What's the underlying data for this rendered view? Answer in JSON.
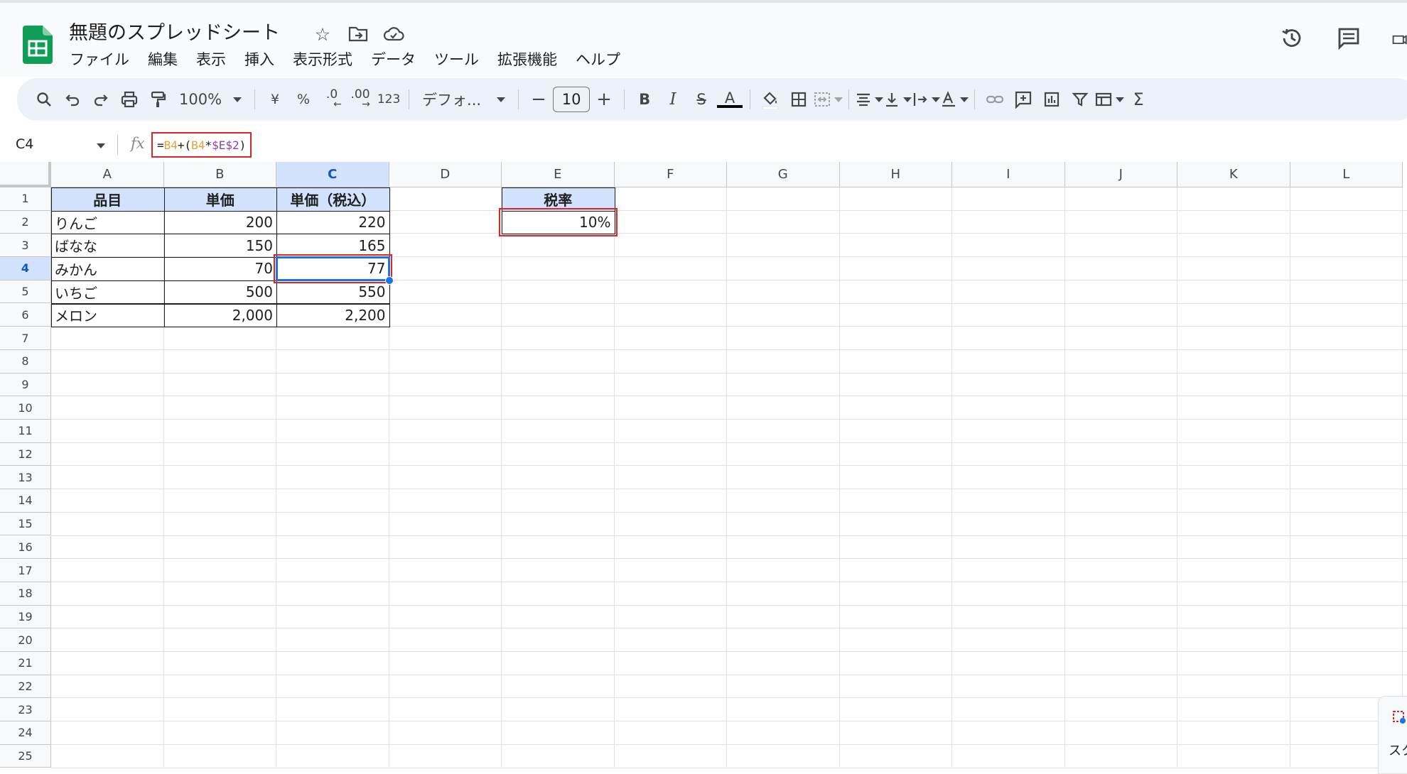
{
  "app": {
    "title": "無題のスプレッドシート",
    "menu": [
      "ファイル",
      "編集",
      "表示",
      "挿入",
      "表示形式",
      "データ",
      "ツール",
      "拡張機能",
      "ヘルプ"
    ]
  },
  "toolbar": {
    "zoom": "100%",
    "currency": "¥",
    "percent": "%",
    "dec_decrease": ".0",
    "dec_increase": ".00",
    "number_format": "123",
    "font": "デフォ...",
    "font_size": "10",
    "bold": "B",
    "italic": "I",
    "text_color": "A"
  },
  "formula_bar": {
    "name_box": "C4",
    "fx": "fx",
    "formula_parts": [
      "=",
      "B4",
      "+(",
      "B4",
      "*",
      "$E$2",
      ")"
    ]
  },
  "sheet": {
    "columns": [
      "A",
      "B",
      "C",
      "D",
      "E",
      "F",
      "G",
      "H",
      "I",
      "J",
      "K",
      "L"
    ],
    "rows": [
      "1",
      "2",
      "3",
      "4",
      "5",
      "6",
      "7",
      "8",
      "9",
      "10",
      "11",
      "12",
      "13",
      "14",
      "15",
      "16",
      "17",
      "18",
      "19",
      "20",
      "21",
      "22",
      "23",
      "24",
      "25"
    ],
    "selected_cell": "C4",
    "table_headers": [
      "品目",
      "単価",
      "単価（税込）"
    ],
    "table_rows": [
      [
        "りんご",
        "200",
        "220"
      ],
      [
        "ばなな",
        "150",
        "165"
      ],
      [
        "みかん",
        "70",
        "77"
      ],
      [
        "いちご",
        "500",
        "550"
      ],
      [
        "メロン",
        "2,000",
        "2,200"
      ]
    ],
    "tax_label": "税率",
    "tax_value": "10%"
  },
  "side_panel": {
    "text": "スク"
  },
  "colors": {
    "accent": "#1a73e8",
    "highlight_red": "#e02424",
    "header_fill": "#d3e3fd",
    "sheets_green": "#0f9d58"
  }
}
